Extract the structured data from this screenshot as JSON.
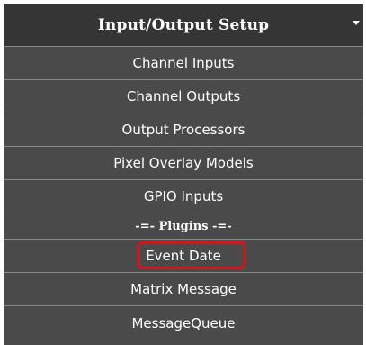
{
  "menu": {
    "title": "Input/Output Setup",
    "caret_icon": "caret-down-icon",
    "items": [
      {
        "label": "Channel Inputs"
      },
      {
        "label": "Channel Outputs"
      },
      {
        "label": "Output Processors"
      },
      {
        "label": "Pixel Overlay Models"
      },
      {
        "label": "GPIO Inputs"
      }
    ],
    "divider_label": "-=- Plugins -=-",
    "plugin_items": [
      {
        "label": "Event Date",
        "highlighted": true
      },
      {
        "label": "Matrix Message"
      },
      {
        "label": "MessageQueue"
      }
    ]
  },
  "colors": {
    "menu_background": "#4a4a4a",
    "header_background": "#353535",
    "divider_line": "#8a8a8a",
    "highlight": "#e0101a",
    "text": "#ffffff"
  }
}
